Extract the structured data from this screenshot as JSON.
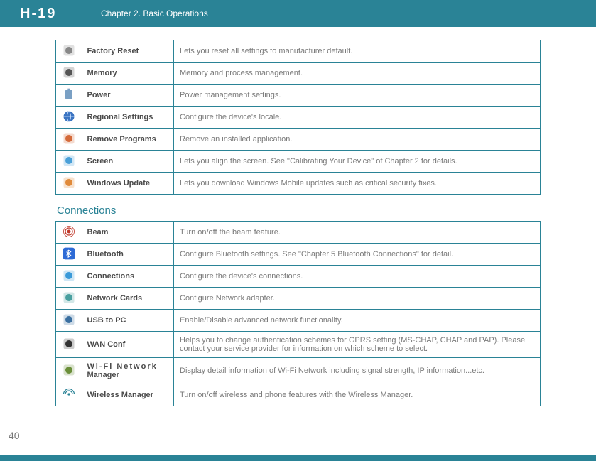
{
  "header": {
    "logo": "H-19",
    "chapter": "Chapter 2. Basic Operations"
  },
  "table1": {
    "rows": [
      {
        "icon": "factory-reset-icon",
        "name": "Factory Reset",
        "desc": "Lets you reset all settings to manufacturer default."
      },
      {
        "icon": "memory-icon",
        "name": "Memory",
        "desc": "Memory and process management."
      },
      {
        "icon": "power-icon",
        "name": "Power",
        "desc": "Power management settings."
      },
      {
        "icon": "regional-icon",
        "name": "Regional Settings",
        "desc": "Configure the device's locale."
      },
      {
        "icon": "remove-programs-icon",
        "name": "Remove Programs",
        "desc": "Remove an installed application."
      },
      {
        "icon": "screen-icon",
        "name": "Screen",
        "desc": "Lets you align the screen. See \"Calibrating Your Device\" of Chapter 2 for details."
      },
      {
        "icon": "windows-update-icon",
        "name": "Windows Update",
        "desc": "Lets you download Windows Mobile updates such as critical security fixes."
      }
    ]
  },
  "section2_heading": "Connections",
  "table2": {
    "rows": [
      {
        "icon": "beam-icon",
        "name": "Beam",
        "desc": "Turn on/off the beam feature."
      },
      {
        "icon": "bluetooth-icon",
        "name": "Bluetooth",
        "desc": "Configure Bluetooth settings. See \"Chapter 5 Bluetooth Connections\" for detail."
      },
      {
        "icon": "connections-icon",
        "name": "Connections",
        "desc": "Configure the device's connections."
      },
      {
        "icon": "network-cards-icon",
        "name": "Network Cards",
        "desc": "Configure Network adapter."
      },
      {
        "icon": "usb-to-pc-icon",
        "name": "USB to PC",
        "desc": "Enable/Disable advanced network functionality."
      },
      {
        "icon": "wan-conf-icon",
        "name": "WAN Conf",
        "desc": "Helps you to change authentication schemes for GPRS setting (MS-CHAP, CHAP and PAP). Please contact your service provider for information on which scheme to select."
      },
      {
        "icon": "wifi-manager-icon",
        "name_html": "wifi",
        "name_line1": "Wi-Fi Network",
        "name_line2": "Manager",
        "desc": "Display detail information of Wi-Fi Network including signal strength, IP information...etc."
      },
      {
        "icon": "wireless-manager-icon",
        "name": "Wireless Manager",
        "desc": "Turn on/off wireless and phone features with the Wireless Manager."
      }
    ]
  },
  "page_number": "40"
}
